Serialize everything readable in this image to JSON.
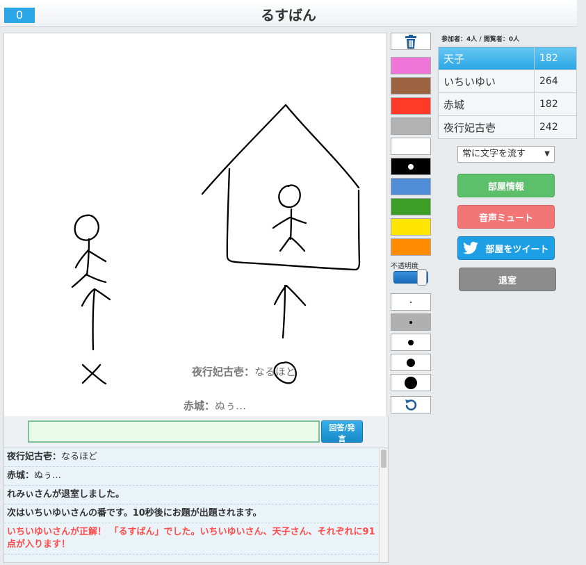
{
  "header": {
    "timer": "0",
    "title": "るすばん"
  },
  "canvas": {
    "overlay_messages": [
      {
        "name": "夜行妃古壱",
        "text": "なるほど"
      },
      {
        "name": "赤城",
        "text": "ぬぅ…"
      }
    ]
  },
  "input": {
    "value": "",
    "send_label": "回答/発言"
  },
  "log": {
    "items": [
      {
        "name": "夜行妃古壱",
        "text": "なるほど",
        "kind": "chat"
      },
      {
        "name": "赤城",
        "text": "ぬぅ…",
        "kind": "chat"
      },
      {
        "text": "れみぃさんが退室しました。",
        "kind": "system"
      },
      {
        "text": "次はいちいゆいさんの番です。10秒後にお題が出題されます。",
        "kind": "system"
      },
      {
        "text": "いちいゆいさんが正解！ 「るすばん」でした。いちいゆいさん、天子さん、それぞれに91点が入ります！",
        "kind": "correct"
      }
    ]
  },
  "tools": {
    "colors": [
      "#f075d8",
      "#9c6440",
      "#ff3b27",
      "#b2b2b2",
      "#ffffff",
      "#000000",
      "#4f8ed6",
      "#3d9e25",
      "#ffe600",
      "#ff8c00"
    ],
    "selected_color": "#000000",
    "opacity_label": "不透明度",
    "opacity": 0.85,
    "brush_sizes": [
      2,
      4,
      8,
      12,
      18
    ],
    "selected_size": 4
  },
  "right": {
    "participants": "参加者：4人 / 閲覧者：0人",
    "players": [
      {
        "name": "天子",
        "score": "182",
        "active": true
      },
      {
        "name": "いちいゆい",
        "score": "264",
        "active": false
      },
      {
        "name": "赤城",
        "score": "182",
        "active": false
      },
      {
        "name": "夜行妃古壱",
        "score": "242",
        "active": false
      }
    ],
    "flow_select": "常に文字を流す",
    "buttons": {
      "room_info": "部屋情報",
      "mute": "音声ミュート",
      "tweet": "部屋をツイート",
      "exit": "退室"
    }
  },
  "accent_colors": {
    "primary": "#2aa6e6",
    "green": "#5cbf69",
    "red": "#f37676",
    "twitter": "#1d9fe6",
    "gray": "#8c8c8c"
  }
}
